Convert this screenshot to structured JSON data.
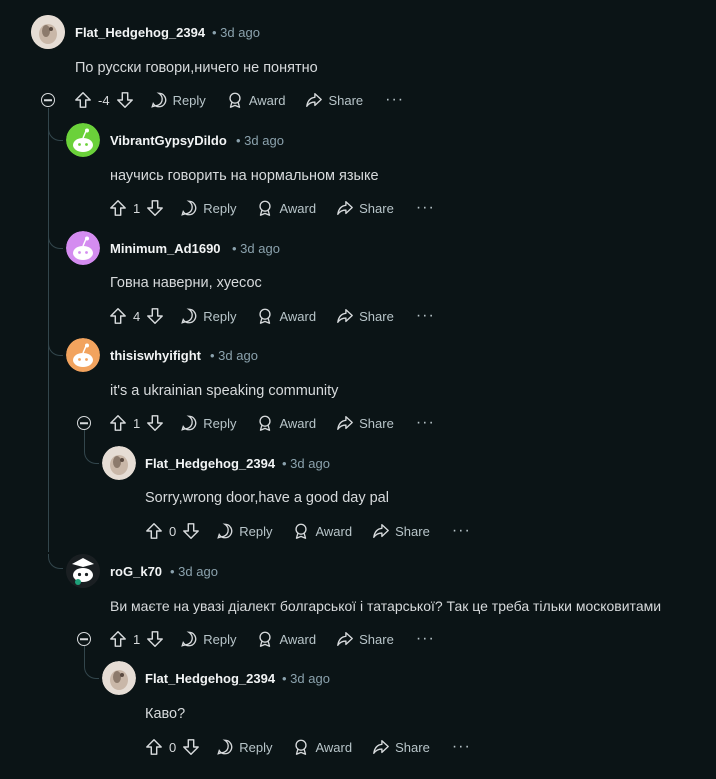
{
  "labels": {
    "reply": "Reply",
    "award": "Award",
    "share": "Share",
    "more": "···"
  },
  "comments": [
    {
      "author": "Flat_Hedgehog_2394",
      "time": "3d ago",
      "text": "По русски говори,ничего не понятно",
      "score": "-4"
    },
    {
      "author": "VibrantGypsyDildo",
      "time": "3d ago",
      "text": "научись говорить на нормальном языке",
      "score": "1"
    },
    {
      "author": "Minimum_Ad1690",
      "time": "3d ago",
      "text": "Говна наверни, хуесос",
      "score": "4"
    },
    {
      "author": "thisiswhyifight",
      "time": "3d ago",
      "text": "it's a ukrainian speaking community",
      "score": "1"
    },
    {
      "author": "Flat_Hedgehog_2394",
      "time": "3d ago",
      "text": "Sorry,wrong door,have a good day pal",
      "score": "0"
    },
    {
      "author": "roG_k70",
      "time": "3d ago",
      "text": "Ви маєте на увазі діалект болгарської і татарської? Так це треба тільки московитами",
      "score": "1"
    },
    {
      "author": "Flat_Hedgehog_2394",
      "time": "3d ago",
      "text": "Каво?",
      "score": "0"
    }
  ]
}
